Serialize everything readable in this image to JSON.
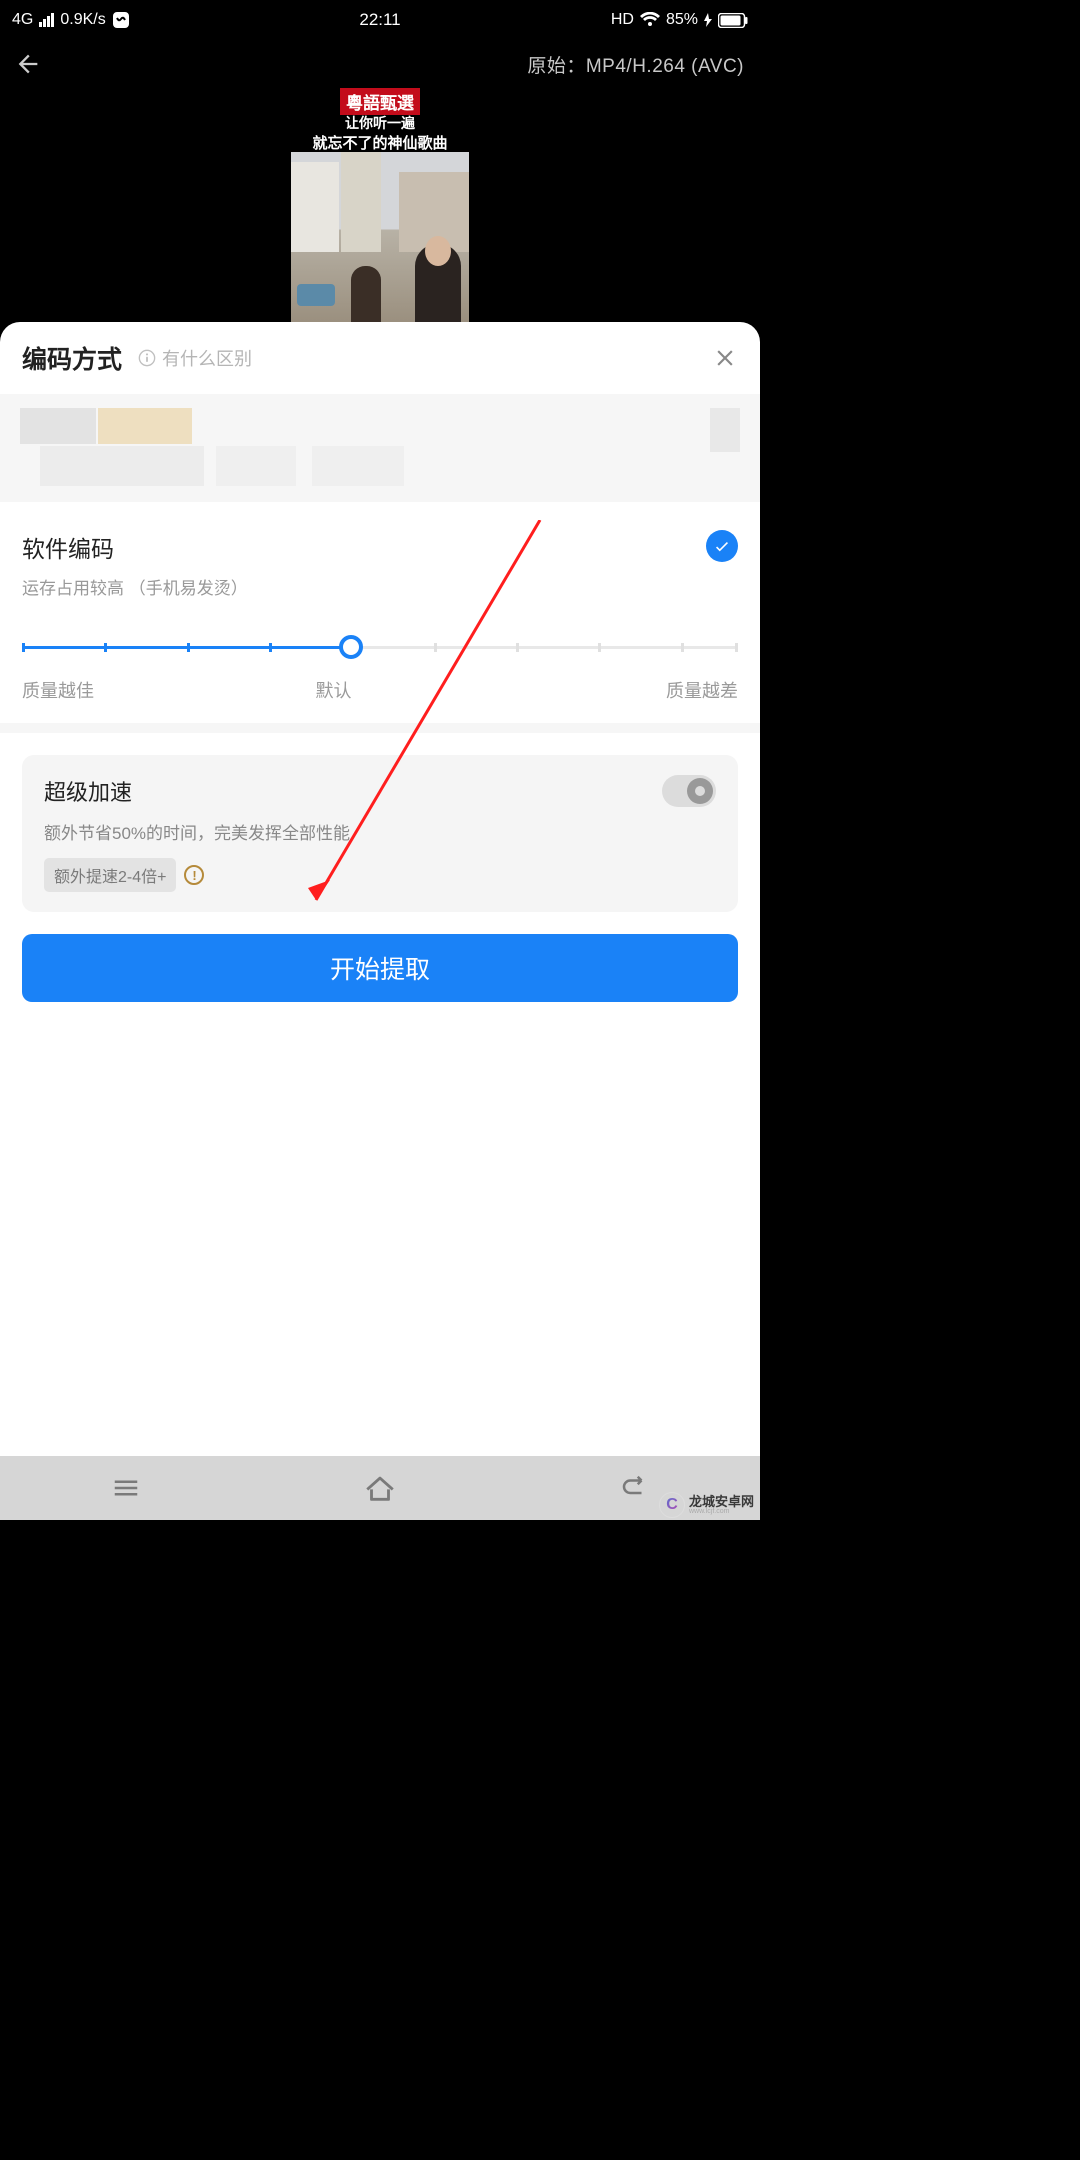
{
  "status": {
    "net": "4G",
    "speed": "0.9K/s",
    "time": "22:11",
    "hd": "HD",
    "battery": "85%"
  },
  "header": {
    "format_label": "原始：",
    "format_value": "MP4/H.264 (AVC)"
  },
  "thumb": {
    "title": "粵語甄選",
    "sub1": "让你听一遍",
    "sub2": "就忘不了的神仙歌曲"
  },
  "sheet": {
    "title": "编码方式",
    "help": "有什么区别",
    "encoding": {
      "title": "软件编码",
      "desc": "运存占用较高 （手机易发烫）"
    },
    "slider": {
      "left": "质量越佳",
      "mid": "默认",
      "right": "质量越差"
    },
    "accel": {
      "title": "超级加速",
      "desc": "额外节省50%的时间，完美发挥全部性能",
      "badge": "额外提速2-4倍+"
    },
    "start": "开始提取"
  },
  "watermark": {
    "brand": "龙城安卓网"
  }
}
